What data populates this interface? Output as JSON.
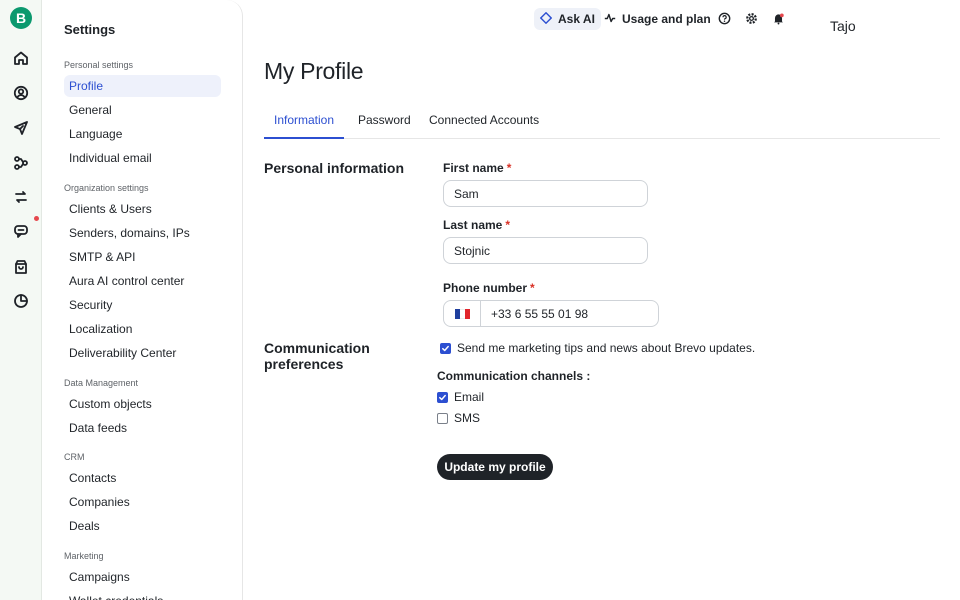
{
  "app": {
    "logo_letter": "B"
  },
  "rail": {
    "icons": [
      "home-icon",
      "contacts-icon",
      "campaigns-icon",
      "automations-icon",
      "transactional-icon",
      "conversations-icon",
      "sales-icon",
      "reports-icon"
    ],
    "notification_color": "#e5484d"
  },
  "topbar": {
    "ask_ai": "Ask AI",
    "usage": "Usage and plan",
    "user_name": "Tajo"
  },
  "sidebar": {
    "title": "Settings",
    "sections": [
      {
        "label": "Personal settings",
        "items": [
          "Profile",
          "General",
          "Language",
          "Individual email"
        ]
      },
      {
        "label": "Organization settings",
        "items": [
          "Clients & Users",
          "Senders, domains, IPs",
          "SMTP & API",
          "Aura AI control center",
          "Security",
          "Localization",
          "Deliverability Center"
        ]
      },
      {
        "label": "Data Management",
        "items": [
          "Custom objects",
          "Data feeds"
        ]
      },
      {
        "label": "CRM",
        "items": [
          "Contacts",
          "Companies",
          "Deals"
        ]
      },
      {
        "label": "Marketing",
        "items": [
          "Campaigns",
          "Wallet credentials"
        ]
      }
    ],
    "active_item": "Profile"
  },
  "main": {
    "title": "My Profile",
    "tabs": [
      "Information",
      "Password",
      "Connected Accounts"
    ],
    "active_tab": "Information",
    "personal": {
      "heading": "Personal information",
      "first_name_label": "First name",
      "first_name_value": "Sam",
      "last_name_label": "Last name",
      "last_name_value": "Stojnic",
      "phone_label": "Phone number",
      "phone_value": "+33 6 55 55 01 98",
      "phone_country": "FR",
      "required_mark": "*"
    },
    "communication": {
      "heading": "Communication preferences",
      "marketing_optin": "Send me marketing tips and news about Brevo updates.",
      "marketing_optin_checked": true,
      "channels_label": "Communication channels :",
      "channels": [
        {
          "label": "Email",
          "checked": true
        },
        {
          "label": "SMS",
          "checked": false
        }
      ]
    },
    "submit_label": "Update my profile"
  },
  "colors": {
    "brand": "#0b996e",
    "accent": "#2c4fd1",
    "primary_button": "#1f2328"
  }
}
